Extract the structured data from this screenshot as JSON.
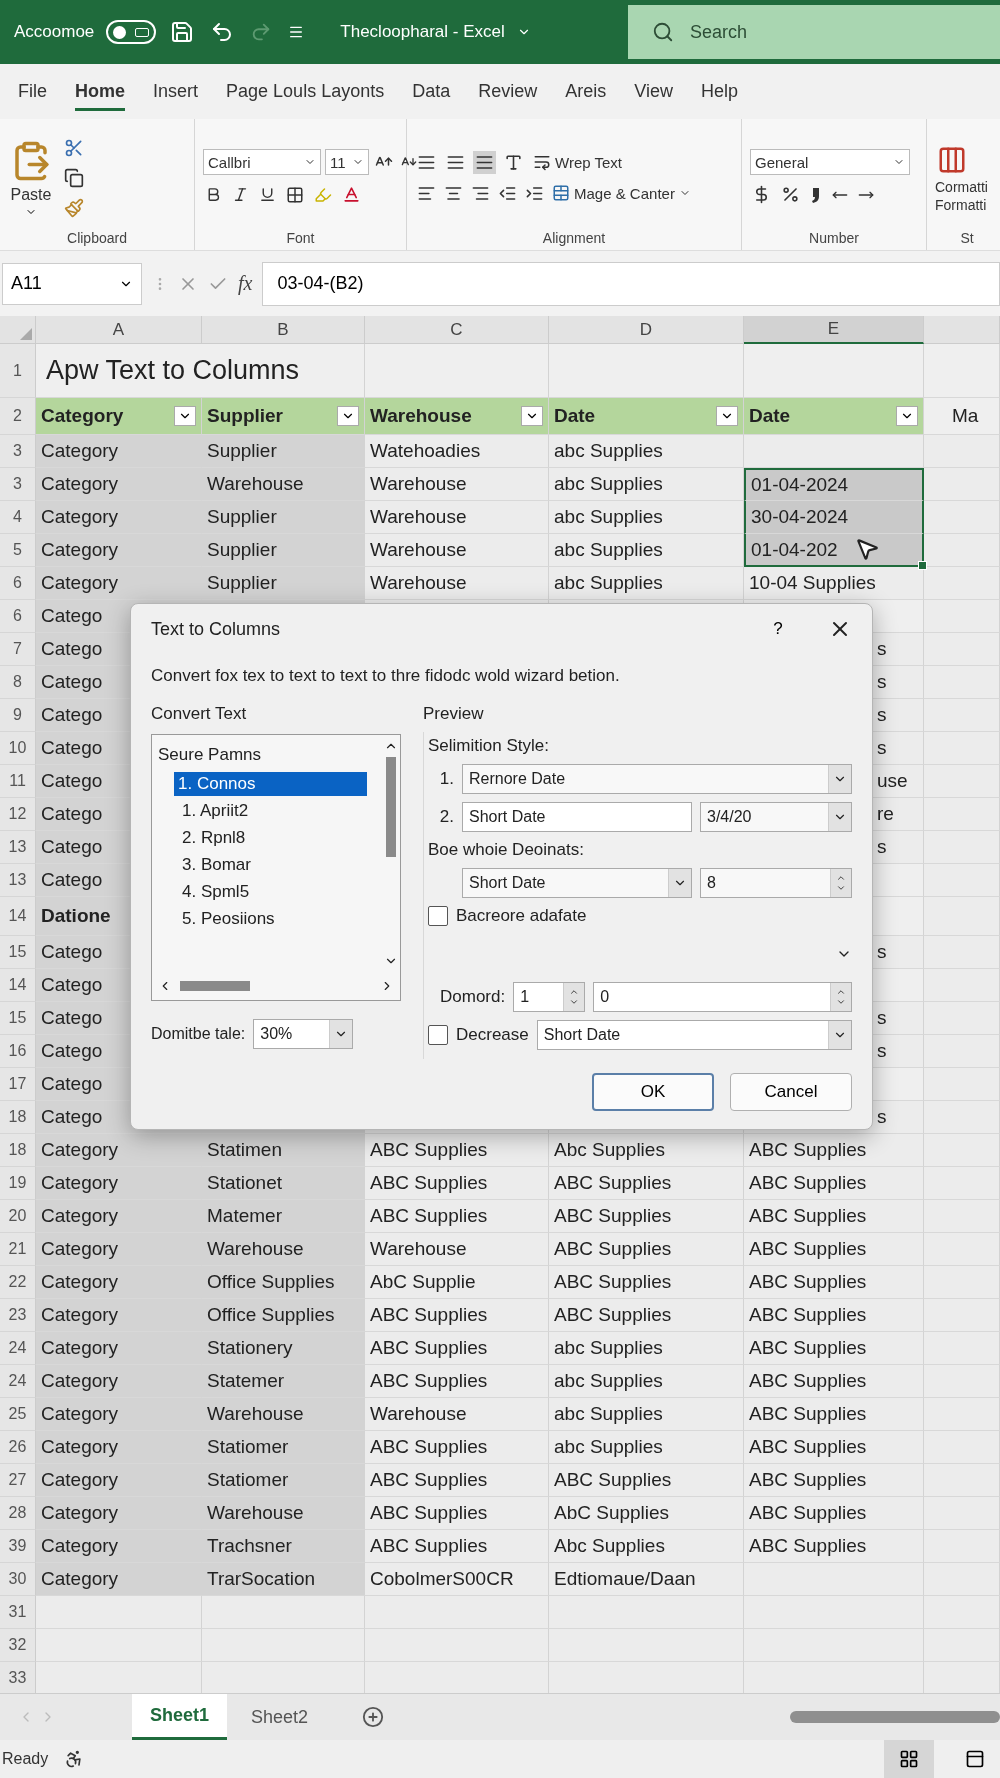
{
  "title_bar": {
    "autosave_label": "Accoomoe",
    "autosave_on": false,
    "title": "Thecloopharal - Excel",
    "search_placeholder": "Search"
  },
  "menu": [
    {
      "label": "File",
      "selected": false
    },
    {
      "label": "Home",
      "selected": true
    },
    {
      "label": "Insert",
      "selected": false
    },
    {
      "label": "Page Louls Layonts",
      "selected": false
    },
    {
      "label": "Data",
      "selected": false
    },
    {
      "label": "Review",
      "selected": false
    },
    {
      "label": "Areis",
      "selected": false
    },
    {
      "label": "View",
      "selected": false
    },
    {
      "label": "Help",
      "selected": false
    }
  ],
  "ribbon": {
    "paste": "Paste",
    "font_name": "Callbri",
    "font_size": "11",
    "wrap_text": "Wrep Text",
    "merge": "Mage & Canter",
    "number_format": "General",
    "styles_lines": [
      "Cormatti",
      "Formatti"
    ],
    "groups": [
      "Clipboard",
      "Font",
      "Alignment",
      "Number",
      "St"
    ]
  },
  "formula_bar": {
    "name_box": "A11",
    "fx_label": "fx",
    "formula": "03-04-(B2)"
  },
  "columns": [
    {
      "label": "A",
      "selected": false
    },
    {
      "label": "B",
      "selected": false
    },
    {
      "label": "C",
      "selected": false
    },
    {
      "label": "D",
      "selected": false
    },
    {
      "label": "E",
      "selected": true
    }
  ],
  "title_row": {
    "num": "1",
    "text": "Apw Text to Columns"
  },
  "header_row": {
    "num": "2",
    "cells": [
      "Category",
      "Supplier",
      "Warehouse",
      "Date",
      "Date"
    ],
    "extra": "Ma"
  },
  "rows": [
    {
      "kind": "data",
      "num": "3",
      "cells": [
        "Category",
        "Supplier",
        "Watehoadies",
        "abc Supplies"
      ],
      "selected": false
    },
    {
      "kind": "data",
      "num": "3",
      "cells": [
        "Category",
        "Warehouse",
        "Warehouse",
        "abc Supplies",
        "01-04-2024"
      ],
      "selected": true
    },
    {
      "kind": "data",
      "num": "4",
      "cells": [
        "Category",
        "Supplier",
        "Warehouse",
        "abc Supplies",
        "30-04-2024"
      ],
      "selected": true
    },
    {
      "kind": "data",
      "num": "5",
      "cells": [
        "Category",
        "Supplier",
        "Warehouse",
        "abc Supplies",
        "01-04-202"
      ],
      "selected": true
    },
    {
      "kind": "data",
      "num": "6",
      "cells": [
        "Category",
        "Supplier",
        "Warehouse",
        "abc Supplies",
        "10-04 Supplies"
      ],
      "selected": false
    },
    {
      "kind": "covered",
      "num": "6",
      "cells": [
        "Catego"
      ],
      "selected": false
    },
    {
      "kind": "covered",
      "num": "7",
      "cells": [
        "Catego"
      ],
      "tail": "s",
      "selected": false
    },
    {
      "kind": "covered",
      "num": "8",
      "cells": [
        "Catego"
      ],
      "tail": "s",
      "selected": false
    },
    {
      "kind": "covered",
      "num": "9",
      "cells": [
        "Catego"
      ],
      "tail": "s",
      "selected": false
    },
    {
      "kind": "covered",
      "num": "10",
      "cells": [
        "Catego"
      ],
      "tail": "s",
      "selected": false
    },
    {
      "kind": "covered",
      "num": "11",
      "cells": [
        "Catego"
      ],
      "tail": "use",
      "selected": false
    },
    {
      "kind": "covered",
      "num": "12",
      "cells": [
        "Catego"
      ],
      "tail": "re",
      "selected": false
    },
    {
      "kind": "covered",
      "num": "13",
      "cells": [
        "Catego"
      ],
      "tail": "s",
      "selected": false
    },
    {
      "kind": "covered",
      "num": "13",
      "cells": [
        "Catego"
      ],
      "selected": false
    },
    {
      "kind": "section",
      "num": "14",
      "cells": [
        "Datione"
      ],
      "selected": false
    },
    {
      "kind": "covered",
      "num": "15",
      "cells": [
        "Catego"
      ],
      "tail": "s",
      "selected": false
    },
    {
      "kind": "covered",
      "num": "14",
      "cells": [
        "Catego"
      ],
      "selected": false
    },
    {
      "kind": "covered",
      "num": "15",
      "cells": [
        "Catego"
      ],
      "tail": "s",
      "selected": false
    },
    {
      "kind": "covered",
      "num": "16",
      "cells": [
        "Catego"
      ],
      "tail": "s",
      "selected": false
    },
    {
      "kind": "covered",
      "num": "17",
      "cells": [
        "Catego"
      ],
      "selected": false
    },
    {
      "kind": "covered",
      "num": "18",
      "cells": [
        "Catego"
      ],
      "tail": "s",
      "selected": false
    },
    {
      "kind": "data",
      "num": "18",
      "cells": [
        "Category",
        "Statimen",
        "ABC Supplies",
        "Abc Supplies",
        "ABC Supplies"
      ],
      "selected": false
    },
    {
      "kind": "data",
      "num": "19",
      "cells": [
        "Category",
        "Stationet",
        "ABC Supplies",
        "ABC Supplies",
        "ABC Supplies"
      ],
      "selected": false
    },
    {
      "kind": "data",
      "num": "20",
      "cells": [
        "Category",
        "Matemer",
        "ABC Supplies",
        "ABC Supplies",
        "ABC Supplies"
      ],
      "selected": false
    },
    {
      "kind": "data",
      "num": "21",
      "cells": [
        "Category",
        "Warehouse",
        "Warehouse",
        "ABC Supplies",
        "ABC Supplies"
      ],
      "selected": false
    },
    {
      "kind": "data",
      "num": "22",
      "cells": [
        "Category",
        "Office Supplies",
        "AbC Supplie",
        "ABC Supplies",
        "ABC Supplies"
      ],
      "selected": false
    },
    {
      "kind": "data",
      "num": "23",
      "cells": [
        "Category",
        "Office Supplies",
        "ABC Supplies",
        "ABC Supplies",
        "ABC Supplies"
      ],
      "selected": false
    },
    {
      "kind": "data",
      "num": "24",
      "cells": [
        "Category",
        "Stationery",
        "ABC Supplies",
        "abc Supplies",
        "ABC Supplies"
      ],
      "selected": false
    },
    {
      "kind": "data",
      "num": "24",
      "cells": [
        "Category",
        "Statemer",
        "ABC Supplies",
        "abc Supplies",
        "ABC Supplies"
      ],
      "selected": false
    },
    {
      "kind": "data",
      "num": "25",
      "cells": [
        "Category",
        "Warehouse",
        "Warehouse",
        "abc Supplies",
        "ABC Supplies"
      ],
      "selected": false
    },
    {
      "kind": "data",
      "num": "26",
      "cells": [
        "Category",
        "Statiomer",
        "ABC Supplies",
        "abc Supplies",
        "ABC Supplies"
      ],
      "selected": false
    },
    {
      "kind": "data",
      "num": "27",
      "cells": [
        "Category",
        "Statiomer",
        "ABC Supplies",
        "ABC Supplies",
        "ABC Supplies"
      ],
      "selected": false
    },
    {
      "kind": "data",
      "num": "28",
      "cells": [
        "Category",
        "Warehouse",
        "ABC Supplies",
        "AbC Supplies",
        "ABC Supplies"
      ],
      "selected": false
    },
    {
      "kind": "data",
      "num": "39",
      "cells": [
        "Category",
        "Trachsner",
        "ABC Supplies",
        "Abc Supplies",
        "ABC Supplies"
      ],
      "selected": false
    },
    {
      "kind": "data",
      "num": "30",
      "cells": [
        "Category",
        "TrarSocation",
        "CobolmerS00CR",
        "Edtiomaue/Daan"
      ],
      "selected": false
    },
    {
      "kind": "empty",
      "num": "31",
      "selected": false
    },
    {
      "kind": "empty",
      "num": "32",
      "selected": false
    },
    {
      "kind": "empty",
      "num": "33",
      "selected": false
    }
  ],
  "dialog": {
    "title": "Text to Columns",
    "help": "?",
    "description": "Convert fox tex to text to text to thre fidodc wold wizard betion.",
    "left_label": "Convert Text",
    "list_header": "Seure Pamns",
    "list_items": [
      {
        "label": "1. Connos",
        "selected": true
      },
      {
        "label": "1. Apriit2",
        "selected": false
      },
      {
        "label": "2. Rpnl8",
        "selected": false
      },
      {
        "label": "3. Bomar",
        "selected": false
      },
      {
        "label": "4. Spml5",
        "selected": false
      },
      {
        "label": "5. Peosiions",
        "selected": false
      }
    ],
    "ratio_label": "Domitbe tale:",
    "ratio_value": "30%",
    "preview_label": "Preview",
    "style_label": "Selimition Style:",
    "style_rows": [
      {
        "num": "1.",
        "value": "Rernore Date"
      },
      {
        "num": "2.",
        "value": "Short Date",
        "extra": "3/4/20"
      }
    ],
    "decimals_label": "Boe whoie Deoinats:",
    "decimals_value": "Short Date",
    "decimals_count": "8",
    "checkbox": {
      "label": "Bacreore adafate",
      "checked": false
    },
    "count_label": "Domord:",
    "count_value": "1",
    "count_second": "0",
    "decrease": {
      "label": "Decrease",
      "checked": false,
      "value": "Short Date"
    },
    "buttons": [
      {
        "label": "OK",
        "kind": "primary"
      },
      {
        "label": "Cancel",
        "kind": "secondary"
      }
    ]
  },
  "sheets": [
    {
      "label": "Sheet1",
      "selected": true
    },
    {
      "label": "Sheet2",
      "selected": false
    }
  ],
  "status": {
    "text": "Ready"
  },
  "views": [
    {
      "kind": "normal",
      "selected": true
    },
    {
      "kind": "page",
      "selected": false
    }
  ]
}
